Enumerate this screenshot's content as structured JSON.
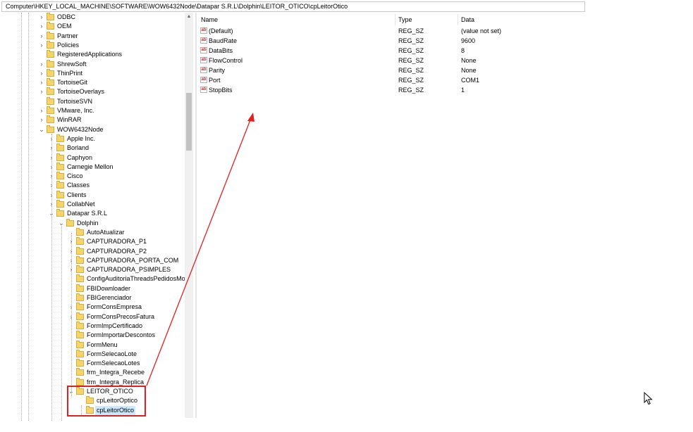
{
  "address_bar": {
    "path": "Computer\\HKEY_LOCAL_MACHINE\\SOFTWARE\\WOW6432Node\\Datapar S.R.L\\Dolphin\\LEITOR_OTICO\\cpLeitorOtico"
  },
  "tree": {
    "items": [
      {
        "label": "ODBC",
        "depth": 0,
        "expander": "collapsed"
      },
      {
        "label": "OEM",
        "depth": 0,
        "expander": "collapsed"
      },
      {
        "label": "Partner",
        "depth": 0,
        "expander": "collapsed"
      },
      {
        "label": "Policies",
        "depth": 0,
        "expander": "collapsed"
      },
      {
        "label": "RegisteredApplications",
        "depth": 0,
        "expander": "none"
      },
      {
        "label": "ShrewSoft",
        "depth": 0,
        "expander": "collapsed"
      },
      {
        "label": "ThinPrint",
        "depth": 0,
        "expander": "collapsed"
      },
      {
        "label": "TortoiseGit",
        "depth": 0,
        "expander": "collapsed"
      },
      {
        "label": "TortoiseOverlays",
        "depth": 0,
        "expander": "collapsed"
      },
      {
        "label": "TortoiseSVN",
        "depth": 0,
        "expander": "none"
      },
      {
        "label": "VMware, Inc.",
        "depth": 0,
        "expander": "collapsed"
      },
      {
        "label": "WinRAR",
        "depth": 0,
        "expander": "collapsed"
      },
      {
        "label": "WOW6432Node",
        "depth": 0,
        "expander": "expanded"
      },
      {
        "label": "Apple Inc.",
        "depth": 1,
        "expander": "collapsed"
      },
      {
        "label": "Borland",
        "depth": 1,
        "expander": "collapsed"
      },
      {
        "label": "Caphyon",
        "depth": 1,
        "expander": "collapsed"
      },
      {
        "label": "Carnegie Mellon",
        "depth": 1,
        "expander": "collapsed"
      },
      {
        "label": "Cisco",
        "depth": 1,
        "expander": "collapsed"
      },
      {
        "label": "Classes",
        "depth": 1,
        "expander": "collapsed"
      },
      {
        "label": "Clients",
        "depth": 1,
        "expander": "collapsed"
      },
      {
        "label": "CollabNet",
        "depth": 1,
        "expander": "collapsed"
      },
      {
        "label": "Datapar S.R.L",
        "depth": 1,
        "expander": "expanded"
      },
      {
        "label": "Dolphin",
        "depth": 2,
        "expander": "expanded"
      },
      {
        "label": "AutoAtualizar",
        "depth": 3,
        "expander": "none"
      },
      {
        "label": "CAPTURADORA_P1",
        "depth": 3,
        "expander": "collapsed"
      },
      {
        "label": "CAPTURADORA_P2",
        "depth": 3,
        "expander": "collapsed"
      },
      {
        "label": "CAPTURADORA_PORTA_COM",
        "depth": 3,
        "expander": "collapsed"
      },
      {
        "label": "CAPTURADORA_PSIMPLES",
        "depth": 3,
        "expander": "collapsed"
      },
      {
        "label": "ConfigAuditoriaThreadsPedidosMo",
        "depth": 3,
        "expander": "none"
      },
      {
        "label": "FBIDownloader",
        "depth": 3,
        "expander": "none"
      },
      {
        "label": "FBIGerenciador",
        "depth": 3,
        "expander": "none"
      },
      {
        "label": "FormConsEmpresa",
        "depth": 3,
        "expander": "collapsed"
      },
      {
        "label": "FormConsPrecosFatura",
        "depth": 3,
        "expander": "collapsed"
      },
      {
        "label": "FormImpCertificado",
        "depth": 3,
        "expander": "none"
      },
      {
        "label": "FormImportarDescontos",
        "depth": 3,
        "expander": "none"
      },
      {
        "label": "FormMenu",
        "depth": 3,
        "expander": "none"
      },
      {
        "label": "FormSelecaoLote",
        "depth": 3,
        "expander": "none"
      },
      {
        "label": "FormSelecaoLotes",
        "depth": 3,
        "expander": "none"
      },
      {
        "label": "frm_Integra_Recebe",
        "depth": 3,
        "expander": "none"
      },
      {
        "label": "frm_Integra_Replica",
        "depth": 3,
        "expander": "none"
      },
      {
        "label": "LEITOR_OTICO",
        "depth": 3,
        "expander": "expanded"
      },
      {
        "label": "cpLeitorOptico",
        "depth": 4,
        "expander": "none"
      },
      {
        "label": "cpLeitorOtico",
        "depth": 4,
        "expander": "none",
        "selected": true
      }
    ]
  },
  "list": {
    "columns": {
      "name": "Name",
      "type": "Type",
      "data": "Data"
    },
    "values": [
      {
        "name": "(Default)",
        "type": "REG_SZ",
        "data": "(value not set)"
      },
      {
        "name": "BaudRate",
        "type": "REG_SZ",
        "data": "9600"
      },
      {
        "name": "DataBits",
        "type": "REG_SZ",
        "data": "8"
      },
      {
        "name": "FlowControl",
        "type": "REG_SZ",
        "data": "None"
      },
      {
        "name": "Parity",
        "type": "REG_SZ",
        "data": "None"
      },
      {
        "name": "Port",
        "type": "REG_SZ",
        "data": "COM1"
      },
      {
        "name": "StopBits",
        "type": "REG_SZ",
        "data": "1"
      }
    ],
    "value_icon": "string-value-icon"
  },
  "colors": {
    "annotation": "#e02020",
    "selection": "#cce8ff",
    "folder": "#f5d46b"
  }
}
